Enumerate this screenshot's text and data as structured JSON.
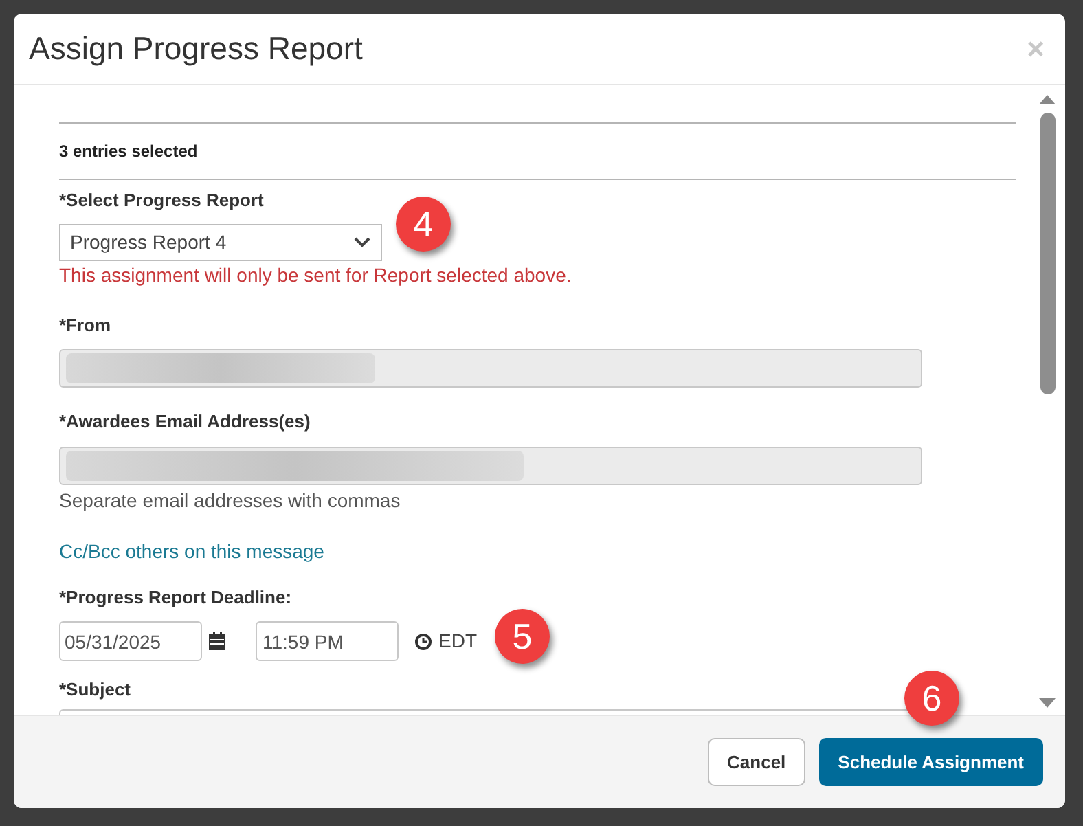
{
  "dialog": {
    "title": "Assign Progress Report",
    "close": "×",
    "selection_summary": "3 entries selected",
    "report_select": {
      "label": "*Select Progress Report",
      "value": "Progress Report 4",
      "note": "This assignment will only be sent for Report selected above.",
      "callout": "4"
    },
    "from": {
      "label": "*From",
      "redacted": true
    },
    "awardees": {
      "label": "*Awardees Email Address(es)",
      "redacted": true,
      "help": "Separate email addresses with commas"
    },
    "cc_link": "Cc/Bcc others on this message",
    "deadline": {
      "label": "*Progress Report Deadline:",
      "date": "05/31/2025",
      "time": "11:59 PM",
      "timezone": "EDT",
      "callout": "5"
    },
    "subject": {
      "label": "*Subject"
    },
    "buttons": [
      {
        "label": "Cancel",
        "kind": "secondary"
      },
      {
        "label": "Schedule Assignment",
        "kind": "primary"
      }
    ],
    "footer_callout": "6"
  }
}
